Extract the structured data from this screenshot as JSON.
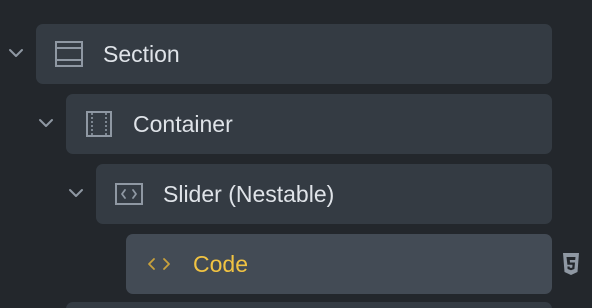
{
  "tree": {
    "items": [
      {
        "label": "Section",
        "icon": "section-icon",
        "expanded": true
      },
      {
        "label": "Container",
        "icon": "container-icon",
        "expanded": true
      },
      {
        "label": "Slider (Nestable)",
        "icon": "slider-icon",
        "expanded": true
      },
      {
        "label": "Code",
        "icon": "code-icon",
        "active": true
      }
    ],
    "side_icon": "css3-icon",
    "colors": {
      "background": "#23272c",
      "node": "#343b43",
      "node_active": "#434b55",
      "text": "#dfe3e8",
      "text_active": "#f1c342",
      "icon": "#8f98a3"
    }
  }
}
